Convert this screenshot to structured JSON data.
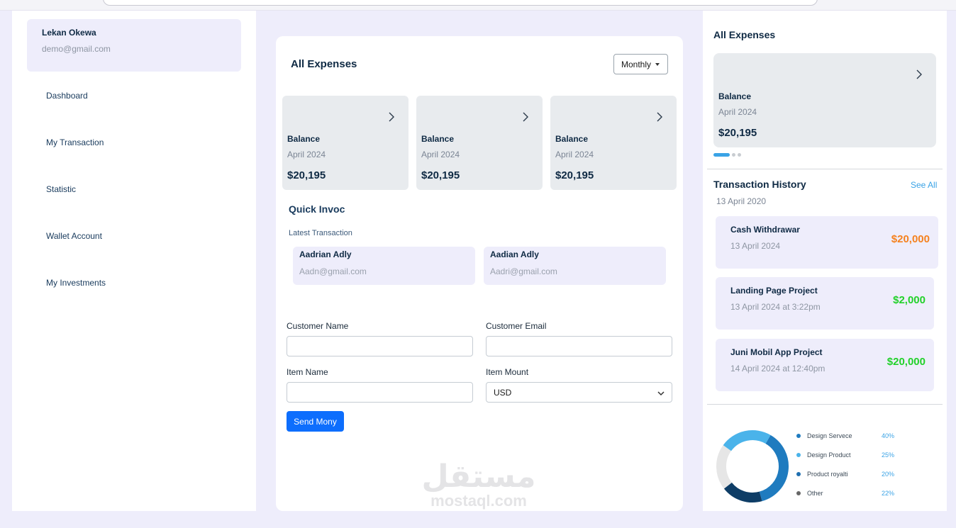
{
  "sidebar": {
    "user_name": "Lekan Okewa",
    "user_email": "demo@gmail.com",
    "items": [
      {
        "label": "Dashboard"
      },
      {
        "label": "My Transaction"
      },
      {
        "label": "Statistic"
      },
      {
        "label": "Wallet Account"
      },
      {
        "label": "My Investments"
      }
    ]
  },
  "main": {
    "title": "All Expenses",
    "period_select": "Monthly",
    "balance_cards": [
      {
        "label": "Balance",
        "date": "April 2024",
        "amount": "$20,195"
      },
      {
        "label": "Balance",
        "date": "April 2024",
        "amount": "$20,195"
      },
      {
        "label": "Balance",
        "date": "April 2024",
        "amount": "$20,195"
      }
    ],
    "quick_invoice": {
      "title": "Quick Invoc",
      "latest_label": "Latest Transaction",
      "contacts": [
        {
          "name": "Aadrian Adly",
          "email": "Aadn@gmail.com"
        },
        {
          "name": "Aadian Adly",
          "email": "Aadri@gmail.com"
        }
      ],
      "customer_name_label": "Customer Name",
      "customer_email_label": "Customer Email",
      "item_name_label": "Item Name",
      "item_amount_label": "Item Mount",
      "currency_value": "USD",
      "send_label": "Send Mony"
    }
  },
  "watermark": {
    "mark": "مستقل",
    "text": "mostaql.com"
  },
  "right": {
    "title": "All Expenses",
    "balance": {
      "label": "Balance",
      "date": "April 2024",
      "amount": "$20,195"
    },
    "history": {
      "title": "Transaction History",
      "see_all": "See All",
      "date": "13 April 2020",
      "items": [
        {
          "title": "Cash Withdrawar",
          "date": "13 April 2024",
          "amount": "$20,000",
          "color": "#f5821f"
        },
        {
          "title": "Landing Page Project",
          "date": "13 April 2024 at 3:22pm",
          "amount": "$2,000",
          "color": "#22d12a"
        },
        {
          "title": "Juni Mobil App Project",
          "date": "14 April 2024 at 12:40pm",
          "amount": "$20,000",
          "color": "#22d12a"
        }
      ]
    },
    "chart_data": {
      "type": "pie",
      "categories": [
        "Design Servece",
        "Design Product",
        "Product royalti",
        "Other"
      ],
      "values": [
        40,
        25,
        20,
        22
      ],
      "labels": [
        "40%",
        "25%",
        "20%",
        "22%"
      ],
      "colors": [
        "#1f7bbf",
        "#4ab3ea",
        "#0e3d66",
        "#e6e6e6"
      ],
      "legend_colors": [
        "#1f7bbf",
        "#4ab3ea",
        "#1f6fb0",
        "#666666"
      ]
    }
  }
}
